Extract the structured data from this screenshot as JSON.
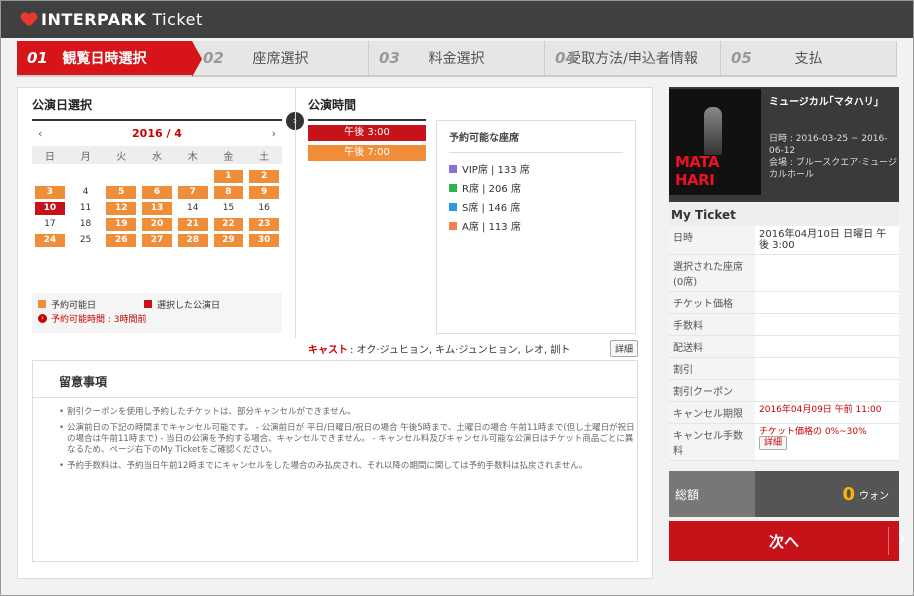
{
  "header": {
    "brand": "INTERPARK",
    "product": "Ticket"
  },
  "steps": [
    {
      "num": "01",
      "label": "観覧日時選択"
    },
    {
      "num": "02",
      "label": "座席選択"
    },
    {
      "num": "03",
      "label": "料金選択"
    },
    {
      "num": "04",
      "label": "受取方法/申込者情報"
    },
    {
      "num": "05",
      "label": "支払"
    }
  ],
  "calendar": {
    "title": "公演日選択",
    "month": "2016 / 4",
    "prev": "‹",
    "next": "›",
    "dow": [
      "日",
      "月",
      "火",
      "水",
      "木",
      "金",
      "土"
    ],
    "days": [
      {
        "d": "",
        "s": ""
      },
      {
        "d": "",
        "s": ""
      },
      {
        "d": "",
        "s": ""
      },
      {
        "d": "",
        "s": ""
      },
      {
        "d": "",
        "s": ""
      },
      {
        "d": "1",
        "s": "av"
      },
      {
        "d": "2",
        "s": "av"
      },
      {
        "d": "3",
        "s": "av"
      },
      {
        "d": "4",
        "s": ""
      },
      {
        "d": "5",
        "s": "av"
      },
      {
        "d": "6",
        "s": "av"
      },
      {
        "d": "7",
        "s": "av"
      },
      {
        "d": "8",
        "s": "av"
      },
      {
        "d": "9",
        "s": "av"
      },
      {
        "d": "10",
        "s": "sel"
      },
      {
        "d": "11",
        "s": ""
      },
      {
        "d": "12",
        "s": "av"
      },
      {
        "d": "13",
        "s": "av"
      },
      {
        "d": "14",
        "s": ""
      },
      {
        "d": "15",
        "s": ""
      },
      {
        "d": "16",
        "s": ""
      },
      {
        "d": "17",
        "s": ""
      },
      {
        "d": "18",
        "s": ""
      },
      {
        "d": "19",
        "s": "av"
      },
      {
        "d": "20",
        "s": "av"
      },
      {
        "d": "21",
        "s": "av"
      },
      {
        "d": "22",
        "s": "av"
      },
      {
        "d": "23",
        "s": "av"
      },
      {
        "d": "24",
        "s": "av"
      },
      {
        "d": "25",
        "s": ""
      },
      {
        "d": "26",
        "s": "av"
      },
      {
        "d": "27",
        "s": "av"
      },
      {
        "d": "28",
        "s": "av"
      },
      {
        "d": "29",
        "s": "av"
      },
      {
        "d": "30",
        "s": "av"
      }
    ],
    "legend_available": "予約可能日",
    "legend_selected": "選択した公演日",
    "note": "予約可能時間 : 3時間前"
  },
  "times": {
    "title": "公演時間",
    "items": [
      {
        "label": "午後 3:00",
        "s": "sel"
      },
      {
        "label": "午後 7:00",
        "s": "av"
      }
    ]
  },
  "seats": {
    "title": "予約可能な座席",
    "items": [
      {
        "label": "VIP席 | 133 席",
        "color": "#8a6fd8"
      },
      {
        "label": "R席 | 206 席",
        "color": "#2db34a"
      },
      {
        "label": "S席 | 146 席",
        "color": "#2a9ae0"
      },
      {
        "label": "A席 | 113 席",
        "color": "#f08050"
      }
    ]
  },
  "cast": {
    "label": "キャスト",
    "names": ": オク·ジュヒョン, キム·ジュンヒョン, レオ, 訓ト",
    "details": "詳細"
  },
  "notice": {
    "title": "留意事項",
    "items": [
      "割引クーポンを使用し予約したチケットは、部分キャンセルができません。",
      "公演前日の下記の時間までキャンセル可能です。 - 公演前日が 平日/日曜日/祝日の場合 午後5時まで、土曜日の場合 午前11時まで(但し土曜日が祝日の場合は午前11時まで) - 当日の公演を予約する場合、キャンセルできません。 - キャンセル料及びキャンセル可能な公演日はチケット商品ごとに異なるため、ページ右下のMy Ticketをご確認ください。",
      "予約手数料は、予約当日午前12時までにキャンセルをした場合のみ払戻され、それ以降の期間に関しては予約手数料は払戻されません。"
    ]
  },
  "show": {
    "title": "ミュージカル｢マタハリ｣",
    "poster_text": "MATA HARI",
    "date": "日時 : 2016-03-25 ~ 2016-06-12",
    "venue": "会場 : ブルースクエア·ミュージカルホール"
  },
  "myticket": {
    "title": "My Ticket",
    "rows": [
      {
        "k": "日時",
        "v": "2016年04月10日 日曜日 午後 3:00"
      },
      {
        "k": "選択された座席 (0席)",
        "v": ""
      },
      {
        "k": "チケット価格",
        "v": ""
      },
      {
        "k": "手数料",
        "v": ""
      },
      {
        "k": "配送料",
        "v": ""
      },
      {
        "k": "割引",
        "v": ""
      },
      {
        "k": "割引クーポン",
        "v": ""
      },
      {
        "k": "キャンセル期限",
        "v": "2016年04月09日 午前 11:00"
      },
      {
        "k": "キャンセル手数料",
        "v": "チケット価格の 0%~30%"
      }
    ],
    "fee_details": "詳細"
  },
  "total": {
    "label": "総額",
    "amount": "0",
    "unit": "ウォン"
  },
  "next": {
    "label": "次へ"
  }
}
